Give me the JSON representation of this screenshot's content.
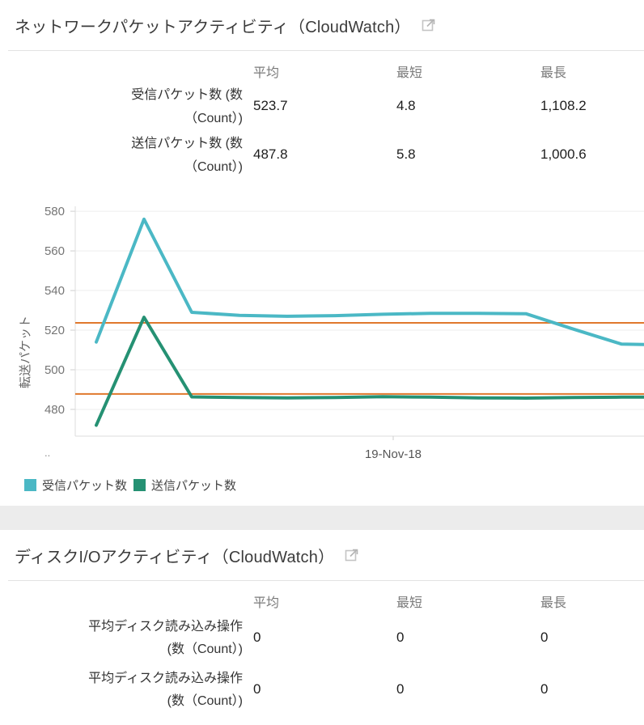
{
  "accent_colors": {
    "teal": "#4BB8C5",
    "green": "#259173",
    "orange": "#E0782D"
  },
  "panel1": {
    "title": "ネットワークパケットアクティビティ（CloudWatch）",
    "table": {
      "headers": {
        "avg": "平均",
        "min": "最短",
        "max": "最長"
      },
      "rows": [
        {
          "label_line1": "受信パケット数 (数",
          "label_line2": "（Count）)",
          "avg": "523.7",
          "min": "4.8",
          "max": "1,108.2"
        },
        {
          "label_line1": "送信パケット数 (数",
          "label_line2": "（Count）)",
          "avg": "487.8",
          "min": "5.8",
          "max": "1,000.6"
        }
      ]
    }
  },
  "chart_data": {
    "type": "line",
    "ylabel": "転送パケット",
    "x_axis_label": "19-Nov-18",
    "x_axis_partial_label": "..",
    "y_ticks": [
      580,
      560,
      540,
      520,
      500,
      480
    ],
    "ylim": [
      466.5,
      582.5
    ],
    "grid": true,
    "legend_position": "bottom",
    "reference_line_color": "#E0782D",
    "series": [
      {
        "name": "受信パケット数",
        "color": "#4BB8C5",
        "average": 523.7,
        "values": [
          514,
          576,
          529,
          527.5,
          527,
          527.3,
          528,
          528.5,
          528.5,
          528.3,
          520.5,
          513,
          512.5
        ]
      },
      {
        "name": "送信パケット数",
        "color": "#259173",
        "average": 487.8,
        "values": [
          472,
          526.5,
          486.3,
          486,
          485.8,
          486,
          486.4,
          486.2,
          485.8,
          485.7,
          486,
          486.2,
          486.2
        ]
      }
    ]
  },
  "panel2": {
    "title": "ディスクI/Oアクティビティ（CloudWatch）",
    "table": {
      "headers": {
        "avg": "平均",
        "min": "最短",
        "max": "最長"
      },
      "rows": [
        {
          "label_line1": "平均ディスク読み込み操作",
          "label_line2": "(数（Count）)",
          "avg": "0",
          "min": "0",
          "max": "0"
        },
        {
          "label_line1": "平均ディスク読み込み操作",
          "label_line2": "(数（Count）)",
          "avg": "0",
          "min": "0",
          "max": "0"
        }
      ]
    }
  }
}
